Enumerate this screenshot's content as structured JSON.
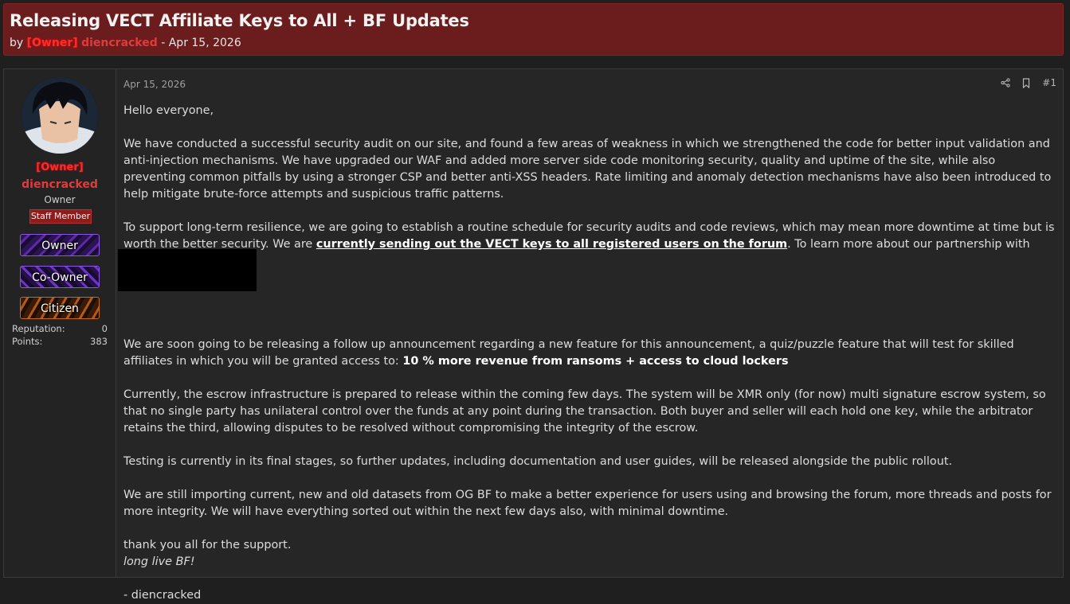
{
  "thread": {
    "title": "Releasing VECT Affiliate Keys to All + BF Updates",
    "by": "by",
    "author_tag": "[Owner]",
    "author_name": "diencracked",
    "sep": "-",
    "date": "Apr 15, 2026"
  },
  "post": {
    "date": "Apr 15, 2026",
    "number": "#1",
    "user": {
      "tag": "[Owner]",
      "name": "diencracked",
      "title": "Owner",
      "badge": "Staff Member",
      "banners": [
        "Owner",
        "Co-Owner",
        "Citizen"
      ],
      "reputation_label": "Reputation:",
      "reputation_value": "0",
      "points_label": "Points:",
      "points_value": "383"
    },
    "body": {
      "greeting": "Hello everyone,",
      "p1": "We have conducted a successful security audit on our site, and found a few areas of weakness in which we strengthened the code for better input validation and anti-injection mechanisms. We have upgraded our WAF and added more server side code monitoring security, quality and uptime of the site, while also preventing common pitfalls by using a stronger CSP and better anti-XSS headers. Rate limiting and anomaly detection mechanisms have also been introduced to help mitigate brute-force attempts and suspicious traffic patterns.",
      "p2_a": "To support long-term resilience, we are going to establish a routine schedule for security audits and code reviews, which may mean more downtime at time but is worth the better security. We are ",
      "p2_link": "currently sending out the VECT keys to all registered users on the forum",
      "p2_b": ". To learn more about our partnership with VECT visit:",
      "p3_a": "We are soon going to be releasing a follow up announcement regarding a new feature for this announcement, a quiz/puzzle feature that will test for skilled affiliates in which you will be granted access to: ",
      "p3_bold": "10 % more revenue from ransoms + access to cloud lockers",
      "p4": "Currently, the escrow infrastructure is prepared to release within the coming few days. The system will be XMR only (for now) multi signature escrow system, so that no single party has unilateral control over the funds at any point during the transaction. Both buyer and seller will each hold one key, while the arbitrator retains the third, allowing disputes to be resolved without compromising the integrity of the escrow.",
      "p5": "Testing is currently in its final stages, so further updates, including documentation and user guides, will be released alongside the public rollout.",
      "p6": "We are still importing current, new and old datasets from OG BF to make a better experience for users using and browsing the forum, more threads and posts for more integrity. We will have everything sorted out within the next few days also, with minimal downtime.",
      "thanks": "thank you all for the support.",
      "long_live": "long live BF!",
      "signoff": "- diencracked"
    }
  },
  "icons": {
    "share": "share-icon",
    "bookmark": "bookmark-icon"
  }
}
